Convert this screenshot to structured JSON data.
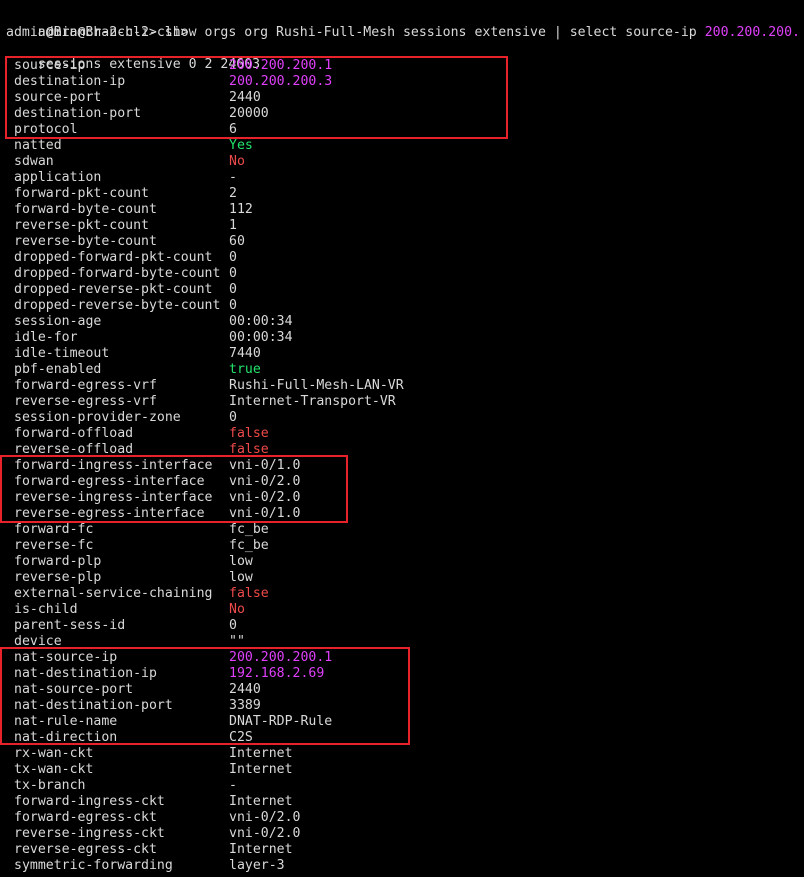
{
  "terminal": {
    "prompt": "admin@Branch-2-cli>",
    "command_prompt": "admin@Branch-2-cli>",
    "command": " show orgs org Rushi-Full-Mesh sessions extensive | select source-ip ",
    "command_ip": "200.200.200.",
    "header": "sessions extensive 0 2 24603",
    "accent_colors": {
      "highlight_box": "#e8222a",
      "ip_value": "#e040fb",
      "true_value": "#22e36a",
      "false_value": "#ef4a4a"
    },
    "rows": [
      {
        "key": "source-ip",
        "value": "200.200.200.1",
        "color": "magenta"
      },
      {
        "key": "destination-ip",
        "value": "200.200.200.3",
        "color": "magenta"
      },
      {
        "key": "source-port",
        "value": "2440",
        "color": "default"
      },
      {
        "key": "destination-port",
        "value": "20000",
        "color": "default"
      },
      {
        "key": "protocol",
        "value": "6",
        "color": "default"
      },
      {
        "key": "natted",
        "value": "Yes",
        "color": "green"
      },
      {
        "key": "sdwan",
        "value": "No",
        "color": "red"
      },
      {
        "key": "application",
        "value": "-",
        "color": "default"
      },
      {
        "key": "forward-pkt-count",
        "value": "2",
        "color": "default"
      },
      {
        "key": "forward-byte-count",
        "value": "112",
        "color": "default"
      },
      {
        "key": "reverse-pkt-count",
        "value": "1",
        "color": "default"
      },
      {
        "key": "reverse-byte-count",
        "value": "60",
        "color": "default"
      },
      {
        "key": "dropped-forward-pkt-count",
        "value": "0",
        "color": "default"
      },
      {
        "key": "dropped-forward-byte-count",
        "value": "0",
        "color": "default"
      },
      {
        "key": "dropped-reverse-pkt-count",
        "value": "0",
        "color": "default"
      },
      {
        "key": "dropped-reverse-byte-count",
        "value": "0",
        "color": "default"
      },
      {
        "key": "session-age",
        "value": "00:00:34",
        "color": "default"
      },
      {
        "key": "idle-for",
        "value": "00:00:34",
        "color": "default"
      },
      {
        "key": "idle-timeout",
        "value": "7440",
        "color": "default"
      },
      {
        "key": "pbf-enabled",
        "value": "true",
        "color": "green"
      },
      {
        "key": "forward-egress-vrf",
        "value": "Rushi-Full-Mesh-LAN-VR",
        "color": "default"
      },
      {
        "key": "reverse-egress-vrf",
        "value": "Internet-Transport-VR",
        "color": "default"
      },
      {
        "key": "session-provider-zone",
        "value": "0",
        "color": "default"
      },
      {
        "key": "forward-offload",
        "value": "false",
        "color": "red"
      },
      {
        "key": "reverse-offload",
        "value": "false",
        "color": "red"
      },
      {
        "key": "forward-ingress-interface",
        "value": "vni-0/1.0",
        "color": "default"
      },
      {
        "key": "forward-egress-interface",
        "value": "vni-0/2.0",
        "color": "default"
      },
      {
        "key": "reverse-ingress-interface",
        "value": "vni-0/2.0",
        "color": "default"
      },
      {
        "key": "reverse-egress-interface",
        "value": "vni-0/1.0",
        "color": "default"
      },
      {
        "key": "forward-fc",
        "value": "fc_be",
        "color": "default"
      },
      {
        "key": "reverse-fc",
        "value": "fc_be",
        "color": "default"
      },
      {
        "key": "forward-plp",
        "value": "low",
        "color": "default"
      },
      {
        "key": "reverse-plp",
        "value": "low",
        "color": "default"
      },
      {
        "key": "external-service-chaining",
        "value": "false",
        "color": "red"
      },
      {
        "key": "is-child",
        "value": "No",
        "color": "red"
      },
      {
        "key": "parent-sess-id",
        "value": "0",
        "color": "default"
      },
      {
        "key": "device",
        "value": "\"\"",
        "color": "default"
      },
      {
        "key": "nat-source-ip",
        "value": "200.200.200.1",
        "color": "magenta"
      },
      {
        "key": "nat-destination-ip",
        "value": "192.168.2.69",
        "color": "magenta"
      },
      {
        "key": "nat-source-port",
        "value": "2440",
        "color": "default"
      },
      {
        "key": "nat-destination-port",
        "value": "3389",
        "color": "default"
      },
      {
        "key": "nat-rule-name",
        "value": "DNAT-RDP-Rule",
        "color": "default"
      },
      {
        "key": "nat-direction",
        "value": "C2S",
        "color": "default"
      },
      {
        "key": "rx-wan-ckt",
        "value": "Internet",
        "color": "default"
      },
      {
        "key": "tx-wan-ckt",
        "value": "Internet",
        "color": "default"
      },
      {
        "key": "tx-branch",
        "value": "-",
        "color": "default"
      },
      {
        "key": "forward-ingress-ckt",
        "value": "Internet",
        "color": "default"
      },
      {
        "key": "forward-egress-ckt",
        "value": "vni-0/2.0",
        "color": "default"
      },
      {
        "key": "reverse-ingress-ckt",
        "value": "vni-0/2.0",
        "color": "default"
      },
      {
        "key": "reverse-egress-ckt",
        "value": "Internet",
        "color": "default"
      },
      {
        "key": "symmetric-forwarding",
        "value": "layer-3",
        "color": "default"
      }
    ]
  }
}
